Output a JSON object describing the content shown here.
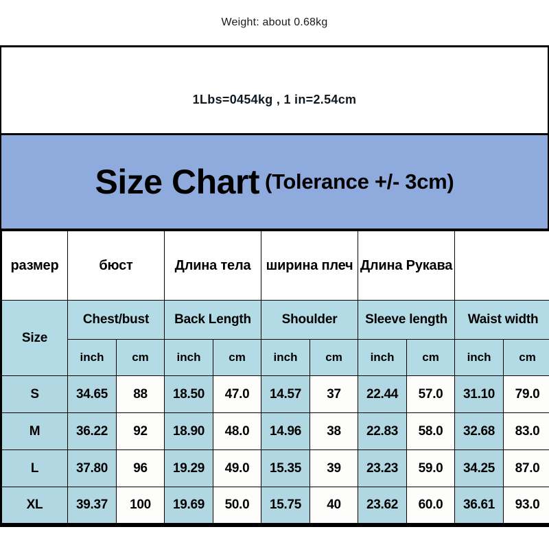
{
  "weight_note": "Weight: about 0.68kg",
  "conversion_note": "1Lbs=0454kg , 1 in=2.54cm",
  "banner": {
    "title": "Size Chart",
    "tolerance": "(Tolerance +/- 3cm)",
    "background_color": "#8fabdd"
  },
  "colors": {
    "banner_blue": "#8fabdd",
    "header_light_blue": "#b3dbe5",
    "cell_light_blue": "#b0d7e2",
    "cell_white": "#fdfdfb",
    "border_black": "#000000"
  },
  "table": {
    "russian_headers": [
      "размер",
      "бюст",
      "Длина тела",
      "ширина плеч",
      "Длина Рукава",
      ""
    ],
    "english_headers": [
      "Chest/bust",
      "Back Length",
      "Shoulder",
      "Sleeve length",
      "Waist width"
    ],
    "size_label": "Size",
    "unit_labels": [
      "inch",
      "cm"
    ],
    "rows": [
      {
        "size": "S",
        "chest_inch": "34.65",
        "chest_cm": "88",
        "back_inch": "18.50",
        "back_cm": "47.0",
        "shoulder_inch": "14.57",
        "shoulder_cm": "37",
        "sleeve_inch": "22.44",
        "sleeve_cm": "57.0",
        "waist_inch": "31.10",
        "waist_cm": "79.0"
      },
      {
        "size": "M",
        "chest_inch": "36.22",
        "chest_cm": "92",
        "back_inch": "18.90",
        "back_cm": "48.0",
        "shoulder_inch": "14.96",
        "shoulder_cm": "38",
        "sleeve_inch": "22.83",
        "sleeve_cm": "58.0",
        "waist_inch": "32.68",
        "waist_cm": "83.0"
      },
      {
        "size": "L",
        "chest_inch": "37.80",
        "chest_cm": "96",
        "back_inch": "19.29",
        "back_cm": "49.0",
        "shoulder_inch": "15.35",
        "shoulder_cm": "39",
        "sleeve_inch": "23.23",
        "sleeve_cm": "59.0",
        "waist_inch": "34.25",
        "waist_cm": "87.0"
      },
      {
        "size": "XL",
        "chest_inch": "39.37",
        "chest_cm": "100",
        "back_inch": "19.69",
        "back_cm": "50.0",
        "shoulder_inch": "15.75",
        "shoulder_cm": "40",
        "sleeve_inch": "23.62",
        "sleeve_cm": "60.0",
        "waist_inch": "36.61",
        "waist_cm": "93.0"
      }
    ]
  },
  "chart_data": {
    "type": "table",
    "title": "Size Chart (Tolerance +/- 3cm)",
    "categories": [
      "S",
      "M",
      "L",
      "XL"
    ],
    "columns": [
      "Size",
      "Chest/bust inch",
      "Chest/bust cm",
      "Back Length inch",
      "Back Length cm",
      "Shoulder inch",
      "Shoulder cm",
      "Sleeve length inch",
      "Sleeve length cm",
      "Waist width inch",
      "Waist width cm"
    ],
    "series": [
      {
        "name": "Chest/bust inch",
        "values": [
          34.65,
          36.22,
          37.8,
          39.37
        ]
      },
      {
        "name": "Chest/bust cm",
        "values": [
          88,
          92,
          96,
          100
        ]
      },
      {
        "name": "Back Length inch",
        "values": [
          18.5,
          18.9,
          19.29,
          19.69
        ]
      },
      {
        "name": "Back Length cm",
        "values": [
          47.0,
          48.0,
          49.0,
          50.0
        ]
      },
      {
        "name": "Shoulder inch",
        "values": [
          14.57,
          14.96,
          15.35,
          15.75
        ]
      },
      {
        "name": "Shoulder cm",
        "values": [
          37,
          38,
          39,
          40
        ]
      },
      {
        "name": "Sleeve length inch",
        "values": [
          22.44,
          22.83,
          23.23,
          23.62
        ]
      },
      {
        "name": "Sleeve length cm",
        "values": [
          57.0,
          58.0,
          59.0,
          60.0
        ]
      },
      {
        "name": "Waist width inch",
        "values": [
          31.1,
          32.68,
          34.25,
          36.61
        ]
      },
      {
        "name": "Waist width cm",
        "values": [
          79.0,
          83.0,
          87.0,
          93.0
        ]
      }
    ],
    "annotations": [
      "Weight: about 0.68kg",
      "1Lbs=0454kg , 1 in=2.54cm"
    ],
    "xlabel": "",
    "ylabel": "",
    "grid": true,
    "legend": "none"
  }
}
